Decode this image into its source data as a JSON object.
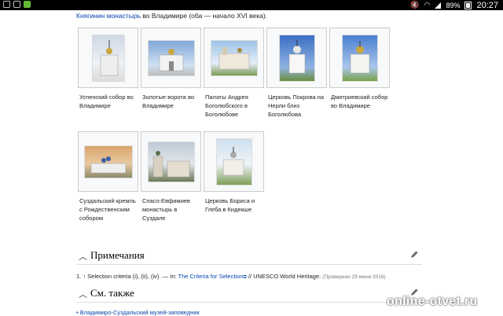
{
  "status_bar": {
    "battery": "89%",
    "time": "20:27"
  },
  "intro": {
    "link": "Княгинин монастырь",
    "text": " во Владимире (оба — начало XVI века)."
  },
  "gallery": [
    {
      "caption": "Успенский собор во Владимире"
    },
    {
      "caption": "Золотые ворота во Владимире"
    },
    {
      "caption": "Палаты Андрея Боголюбского в Боголюбове"
    },
    {
      "caption": "Церковь Покрова на Нерли близ Боголюбова"
    },
    {
      "caption": "Дмитриевский собор во Владимире"
    },
    {
      "caption": "Суздальский кремль с Рождественским собором"
    },
    {
      "caption": "Спасо-Евфимиев монастырь в Суздале"
    },
    {
      "caption": "Церковь Бориса и Глеба в Кидекше"
    }
  ],
  "notes_section": {
    "title": "Примечания"
  },
  "note": {
    "prefix": "1. ↑ Selection criteria (i), (ii), (iv). — In: ",
    "link": "The Criteria for Selection",
    "suffix": " // UNESCO World Heritage. ",
    "checked": "(Проверено 29 июня 2016)"
  },
  "see_also": {
    "title": "См. также"
  },
  "bottom_link": "• Владимиро-Суздальский музей-заповедник",
  "watermark": "online-otvet.ru"
}
